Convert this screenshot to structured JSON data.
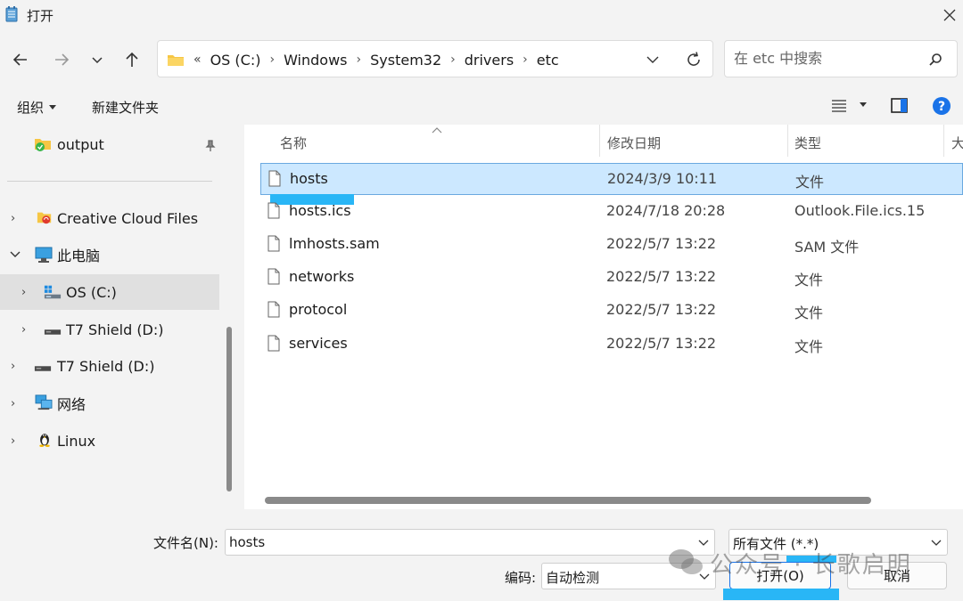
{
  "window": {
    "title": "打开"
  },
  "address": {
    "overflow": "«",
    "crumbs": [
      "OS (C:)",
      "Windows",
      "System32",
      "drivers",
      "etc"
    ]
  },
  "search": {
    "placeholder": "在 etc 中搜索"
  },
  "toolbar": {
    "organize": "组织",
    "new_folder": "新建文件夹"
  },
  "sidebar": {
    "pinned": {
      "label": "output"
    },
    "items": [
      {
        "label": "Creative Cloud Files"
      },
      {
        "label": "此电脑"
      },
      {
        "label": "OS (C:)"
      },
      {
        "label": "T7 Shield (D:)"
      },
      {
        "label": "T7 Shield (D:)"
      },
      {
        "label": "网络"
      },
      {
        "label": "Linux"
      }
    ]
  },
  "columns": {
    "name": "名称",
    "date": "修改日期",
    "type": "类型",
    "size": "大"
  },
  "files": [
    {
      "name": "hosts",
      "date": "2024/3/9 10:11",
      "type": "文件"
    },
    {
      "name": "hosts.ics",
      "date": "2024/7/18 20:28",
      "type": "Outlook.File.ics.15"
    },
    {
      "name": "lmhosts.sam",
      "date": "2022/5/7 13:22",
      "type": "SAM 文件"
    },
    {
      "name": "networks",
      "date": "2022/5/7 13:22",
      "type": "文件"
    },
    {
      "name": "protocol",
      "date": "2022/5/7 13:22",
      "type": "文件"
    },
    {
      "name": "services",
      "date": "2022/5/7 13:22",
      "type": "文件"
    }
  ],
  "bottom": {
    "filename_label": "文件名(N):",
    "filename_value": "hosts",
    "filter_value": "所有文件 (*.*)",
    "encoding_label": "编码:",
    "encoding_value": "自动检测",
    "open_button": "打开(O)",
    "cancel_button": "取消"
  },
  "watermark": "公众号 · 长歌启明",
  "colors": {
    "selection": "#cce8ff",
    "highlight": "#29b6f6",
    "help": "#1a73e8"
  }
}
